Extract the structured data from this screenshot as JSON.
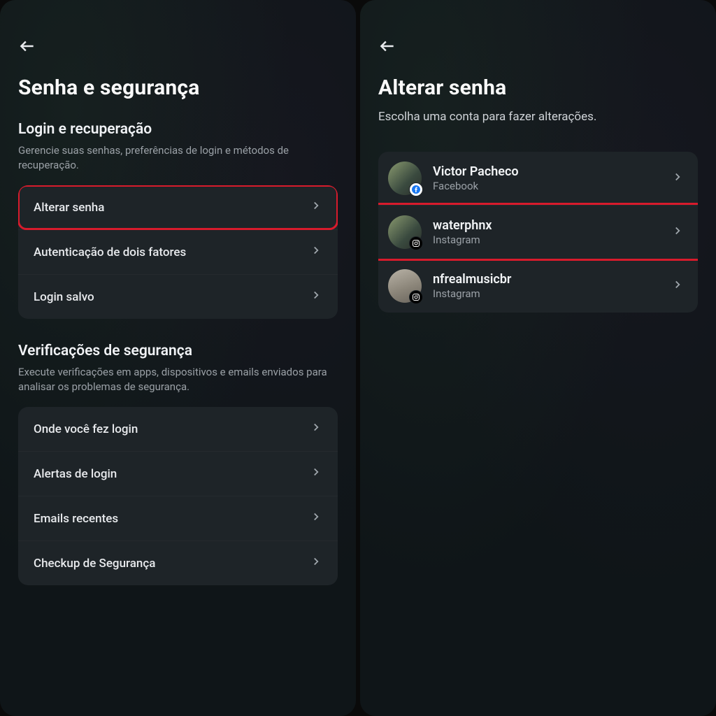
{
  "left": {
    "title": "Senha e segurança",
    "section1": {
      "title": "Login e recuperação",
      "desc": "Gerencie suas senhas, preferências de login e métodos de recuperação.",
      "items": [
        {
          "label": "Alterar senha"
        },
        {
          "label": "Autenticação de dois fatores"
        },
        {
          "label": "Login salvo"
        }
      ]
    },
    "section2": {
      "title": "Verificações de segurança",
      "desc": "Execute verificações em apps, dispositivos e emails enviados para analisar os problemas de segurança.",
      "items": [
        {
          "label": "Onde você fez login"
        },
        {
          "label": "Alertas de login"
        },
        {
          "label": "Emails recentes"
        },
        {
          "label": "Checkup de Segurança"
        }
      ]
    }
  },
  "right": {
    "title": "Alterar senha",
    "subtitle": "Escolha uma conta para fazer alterações.",
    "accounts": [
      {
        "name": "Victor Pacheco",
        "platform": "Facebook"
      },
      {
        "name": "waterphnx",
        "platform": "Instagram"
      },
      {
        "name": "nfrealmusicbr",
        "platform": "Instagram"
      }
    ]
  }
}
